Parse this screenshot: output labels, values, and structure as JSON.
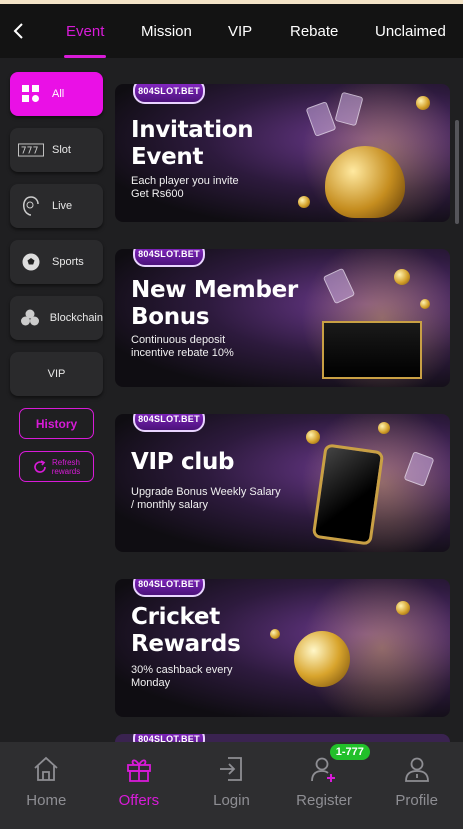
{
  "tabs": [
    {
      "label": "Event",
      "active": true
    },
    {
      "label": "Mission",
      "active": false
    },
    {
      "label": "VIP",
      "active": false
    },
    {
      "label": "Rebate",
      "active": false
    },
    {
      "label": "Unclaimed",
      "active": false
    }
  ],
  "sidebar": {
    "categories": [
      {
        "label": "All",
        "icon": "grid-icon",
        "active": true
      },
      {
        "label": "Slot",
        "icon": "slot-machine-icon",
        "active": false
      },
      {
        "label": "Live",
        "icon": "dealer-icon",
        "active": false
      },
      {
        "label": "Sports",
        "icon": "soccer-ball-icon",
        "active": false
      },
      {
        "label": "Blockchain",
        "icon": "blockchain-icon",
        "active": false
      },
      {
        "label": "VIP",
        "icon": "",
        "active": false
      }
    ],
    "history_label": "History",
    "refresh_label_1": "Refresh",
    "refresh_label_2": "rewards"
  },
  "banners": [
    {
      "logo": "804SLOT.BET",
      "title_line1": "Invitation",
      "title_line2": "Event",
      "sub_line1": "Each player you invite",
      "sub_line2": "Get Rs600"
    },
    {
      "logo": "804SLOT.BET",
      "title_line1": "New Member",
      "title_line2": "Bonus",
      "sub_line1": "Continuous deposit",
      "sub_line2": "incentive rebate 10%"
    },
    {
      "logo": "804SLOT.BET",
      "title_line1": "VIP club",
      "title_line2": "",
      "sub_line1": "Upgrade Bonus Weekly Salary",
      "sub_line2": "/ monthly salary"
    },
    {
      "logo": "804SLOT.BET",
      "title_line1": "Cricket",
      "title_line2": "Rewards",
      "sub_line1": "30% cashback every",
      "sub_line2": "Monday"
    }
  ],
  "partial_banner_logo": "804SLOT.BET",
  "bottom_nav": [
    {
      "label": "Home",
      "icon": "home-icon",
      "active": false
    },
    {
      "label": "Offers",
      "icon": "gift-icon",
      "active": true
    },
    {
      "label": "Login",
      "icon": "login-icon",
      "active": false
    },
    {
      "label": "Register",
      "icon": "add-user-icon",
      "active": false
    },
    {
      "label": "Profile",
      "icon": "user-icon",
      "active": false
    }
  ],
  "register_badge": "1-777",
  "colors": {
    "accent": "#d81bd8",
    "active_category": "#ea10e6",
    "badge": "#22c02a",
    "nav_bg": "#2e2e30"
  }
}
